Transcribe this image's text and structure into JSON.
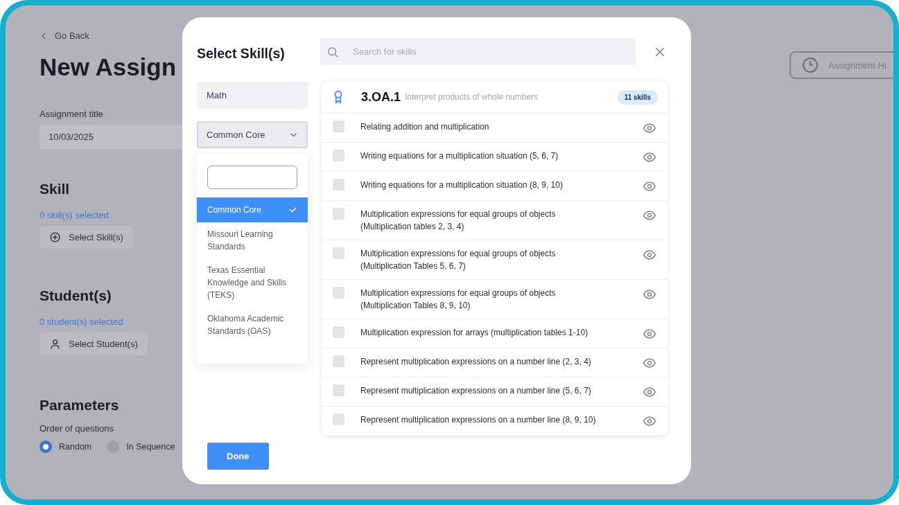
{
  "background_page": {
    "back_link": "Go Back",
    "title": "New Assign",
    "assignment_title": {
      "label": "Assignment title",
      "value": "10/03/2025"
    },
    "skill": {
      "heading": "Skill",
      "count": "0 skill(s) selected",
      "button": "Select Skill(s)"
    },
    "students": {
      "heading": "Student(s)",
      "count": "0 student(s) selected",
      "button": "Select Student(s)"
    },
    "parameters": {
      "heading": "Parameters",
      "order_label": "Order of questions",
      "options": [
        {
          "label": "Random",
          "selected": true
        },
        {
          "label": "In Sequence",
          "selected": false
        }
      ]
    },
    "history_button": "Assignment Hi"
  },
  "modal": {
    "title": "Select Skill(s)",
    "subject_field": {
      "value": "Math"
    },
    "standard_select": {
      "value": "Common Core"
    },
    "dropdown": {
      "options": [
        {
          "label": "Common Core",
          "selected": true
        },
        {
          "label": "Missouri Learning Standards",
          "selected": false
        },
        {
          "label": "Texas Essential Knowledge and Skills (TEKS)",
          "selected": false
        },
        {
          "label": "Oklahoma Academic Standards (OAS)",
          "selected": false
        }
      ]
    },
    "search": {
      "placeholder": "Search for skills"
    },
    "standard": {
      "code": "3.OA.1",
      "description": "Interpret products of whole numbers",
      "count": "11 skills"
    },
    "skills": [
      {
        "label": "Relating addition and multiplication",
        "checked": false
      },
      {
        "label": "Writing equations for a multiplication situation (5, 6, 7)",
        "checked": false
      },
      {
        "label": "Writing equations for a multiplication situation (8, 9, 10)",
        "checked": false
      },
      {
        "label": "Multiplication expressions for equal groups of objects (Multiplication tables 2, 3, 4)",
        "checked": false
      },
      {
        "label": "Multiplication expressions for equal groups of objects (Multiplication Tables 5, 6, 7)",
        "checked": false
      },
      {
        "label": "Multiplication expressions for equal groups of objects (Multiplication Tables 8, 9, 10)",
        "checked": false
      },
      {
        "label": "Multiplication expression for arrays (multiplication tables 1-10)",
        "checked": false
      },
      {
        "label": "Represent multiplication expressions on a number line (2, 3, 4)",
        "checked": false
      },
      {
        "label": "Represent multiplication expressions on a number line (5, 6, 7)",
        "checked": false
      },
      {
        "label": "Represent multiplication expressions on a number line (8, 9, 10)",
        "checked": false
      }
    ],
    "done_button": "Done"
  }
}
